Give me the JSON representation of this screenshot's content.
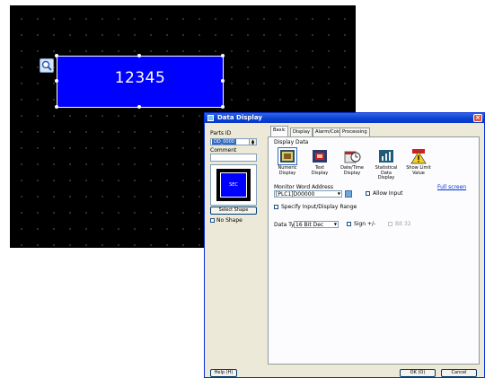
{
  "canvas": {
    "part_value": "12345"
  },
  "dialog": {
    "title": "Data Display",
    "close_label": "×",
    "parts_id_label": "Parts ID",
    "parts_id_value": "DD_0000",
    "comment_label": "Comment",
    "comment_value": "",
    "preview_text": "SEC",
    "select_shape_label": "Select Shape",
    "no_shape_label": "No Shape",
    "tabs": [
      {
        "label": "Basic"
      },
      {
        "label": "Display"
      },
      {
        "label": "Alarm/Color"
      },
      {
        "label": "Processing"
      }
    ],
    "display_data_label": "Display Data",
    "data_types": [
      {
        "label": "Numeric Display",
        "icon": "numeric-display-icon"
      },
      {
        "label": "Text Display",
        "icon": "text-display-icon"
      },
      {
        "label": "Date/Time Display",
        "icon": "date-time-icon"
      },
      {
        "label": "Statistical Data Display",
        "icon": "statistics-icon"
      },
      {
        "label": "Show Limit Value",
        "icon": "warning-icon"
      }
    ],
    "monitor_word_label": "Monitor Word Address",
    "monitor_word_value": "[PLC1]D00000",
    "allow_input_label": "Allow Input",
    "full_screen_link": "Full screen",
    "specify_range_label": "Specify Input/Display Range",
    "data_type_label": "Data Type",
    "data_type_value": "16 Bit Dec",
    "signed_label": "Sign +/-",
    "bit_label": "Bit 32",
    "help_label": "Help (H)",
    "ok_label": "OK (O)",
    "cancel_label": "Cancel"
  },
  "colors": {
    "canvas_bg": "#000000",
    "part_fill": "#0000ff",
    "titlebar": "#0a3fd0",
    "dialog_bg": "#ece9d8"
  }
}
